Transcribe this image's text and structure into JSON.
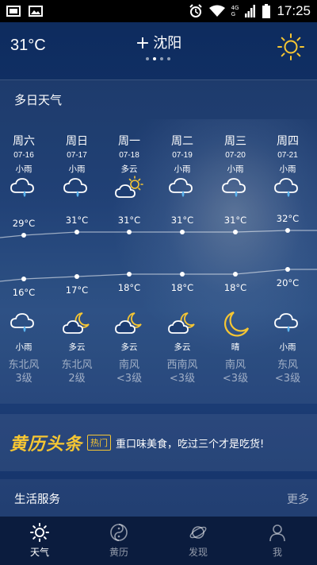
{
  "status_bar": {
    "time": "17:25",
    "network_top": "4G",
    "network_bottom": "G"
  },
  "header": {
    "current_temp": "31°C",
    "city": "沈阳",
    "add_symbol": "+",
    "page_dots": 4,
    "active_dot": 1
  },
  "forecast": {
    "title": "多日天气",
    "days": [
      {
        "weekday": "周六",
        "date": "07-16",
        "day_cond": "小雨",
        "day_icon": "rain-icon",
        "high": "29°C",
        "low": "16°C",
        "night_icon": "rain-icon",
        "night_cond": "小雨",
        "wind_dir": "东北风",
        "wind_level": "3级"
      },
      {
        "weekday": "周日",
        "date": "07-17",
        "day_cond": "小雨",
        "day_icon": "rain-icon",
        "high": "31°C",
        "low": "17°C",
        "night_icon": "cloudy-moon-icon",
        "night_cond": "多云",
        "wind_dir": "东北风",
        "wind_level": "2级"
      },
      {
        "weekday": "周一",
        "date": "07-18",
        "day_cond": "多云",
        "day_icon": "cloudy-sun-icon",
        "high": "31°C",
        "low": "18°C",
        "night_icon": "cloudy-moon-icon",
        "night_cond": "多云",
        "wind_dir": "南风",
        "wind_level": "<3级"
      },
      {
        "weekday": "周二",
        "date": "07-19",
        "day_cond": "小雨",
        "day_icon": "rain-icon",
        "high": "31°C",
        "low": "18°C",
        "night_icon": "cloudy-moon-icon",
        "night_cond": "多云",
        "wind_dir": "西南风",
        "wind_level": "<3级"
      },
      {
        "weekday": "周三",
        "date": "07-20",
        "day_cond": "小雨",
        "day_icon": "rain-icon",
        "high": "31°C",
        "low": "18°C",
        "night_icon": "moon-icon",
        "night_cond": "晴",
        "wind_dir": "南风",
        "wind_level": "<3级"
      },
      {
        "weekday": "周四",
        "date": "07-21",
        "day_cond": "小雨",
        "day_icon": "rain-icon",
        "high": "32°C",
        "low": "20°C",
        "night_icon": "rain-icon",
        "night_cond": "小雨",
        "wind_dir": "东风",
        "wind_level": "<3级"
      }
    ]
  },
  "chart_data": {
    "type": "line",
    "categories": [
      "周六",
      "周日",
      "周一",
      "周二",
      "周三",
      "周四"
    ],
    "series": [
      {
        "values": [
          29,
          31,
          31,
          31,
          31,
          32
        ]
      },
      {
        "values": [
          16,
          17,
          18,
          18,
          18,
          20
        ]
      }
    ]
  },
  "banner": {
    "logo_text": "黄历头条",
    "tag": "热门",
    "headline": "重口味美食，吃过三个才是吃货!"
  },
  "life_services": {
    "title": "生活服务",
    "more": "更多"
  },
  "bottom_nav": [
    {
      "label": "天气",
      "icon": "sun-icon",
      "active": true
    },
    {
      "label": "黄历",
      "icon": "yin-yang-icon",
      "active": false
    },
    {
      "label": "发现",
      "icon": "planet-icon",
      "active": false
    },
    {
      "label": "我",
      "icon": "user-icon",
      "active": false
    }
  ],
  "colors": {
    "accent_gold": "#f6c633",
    "nav_bg": "#0b1c3e"
  }
}
